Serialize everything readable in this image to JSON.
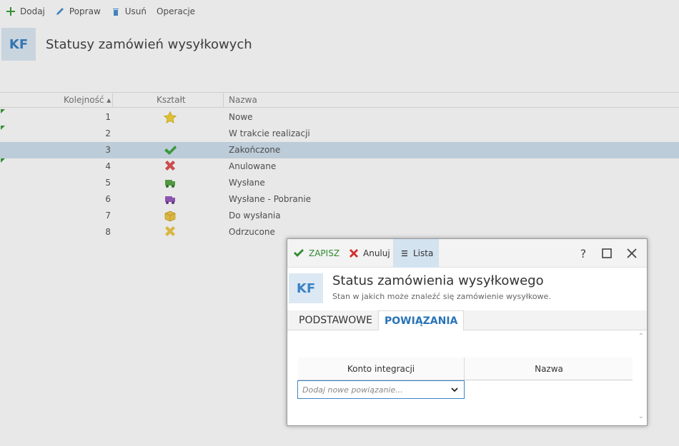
{
  "background": {
    "toolbar": {
      "add_label": "Dodaj",
      "edit_label": "Popraw",
      "delete_label": "Usuń",
      "operations_label": "Operacje"
    },
    "logo": "KF",
    "title": "Statusy zamówień wysyłkowych",
    "grid": {
      "columns": [
        "Kolejność",
        "Kształt",
        "Nazwa"
      ],
      "rows": [
        {
          "order": "1",
          "shape": "star-icon",
          "name": "Nowe",
          "marked": true
        },
        {
          "order": "2",
          "shape": "",
          "name": "W trakcie realizacji",
          "marked": true
        },
        {
          "order": "3",
          "shape": "check-icon",
          "name": "Zakończone",
          "selected": true
        },
        {
          "order": "4",
          "shape": "x-icon",
          "name": "Anulowane",
          "marked": true
        },
        {
          "order": "5",
          "shape": "truck-green-icon",
          "name": "Wysłane"
        },
        {
          "order": "6",
          "shape": "truck-purple-icon",
          "name": "Wysłane - Pobranie"
        },
        {
          "order": "7",
          "shape": "box-icon",
          "name": "Do wysłania"
        },
        {
          "order": "8",
          "shape": "x-yellow-icon",
          "name": "Odrzucone"
        }
      ]
    }
  },
  "dialog": {
    "toolbar": {
      "save_label": "ZAPISZ",
      "cancel_label": "Anuluj",
      "list_label": "Lista",
      "help": "?"
    },
    "logo": "KF",
    "title": "Status zamówienia wysyłkowego",
    "subtitle": "Stan w jakich może znaleźć się zamówienie wysyłkowe.",
    "tabs": [
      "PODSTAWOWE",
      "POWIĄZANIA"
    ],
    "grid": {
      "columns": [
        "Konto integracji",
        "Nazwa"
      ],
      "combo_placeholder": "Dodaj nowe powiązanie..."
    }
  },
  "colors": {
    "accent": "#2874b8",
    "save_green": "#2e8b2e",
    "cancel_red": "#d32f2f",
    "selected_row": "#cfe1ef"
  }
}
